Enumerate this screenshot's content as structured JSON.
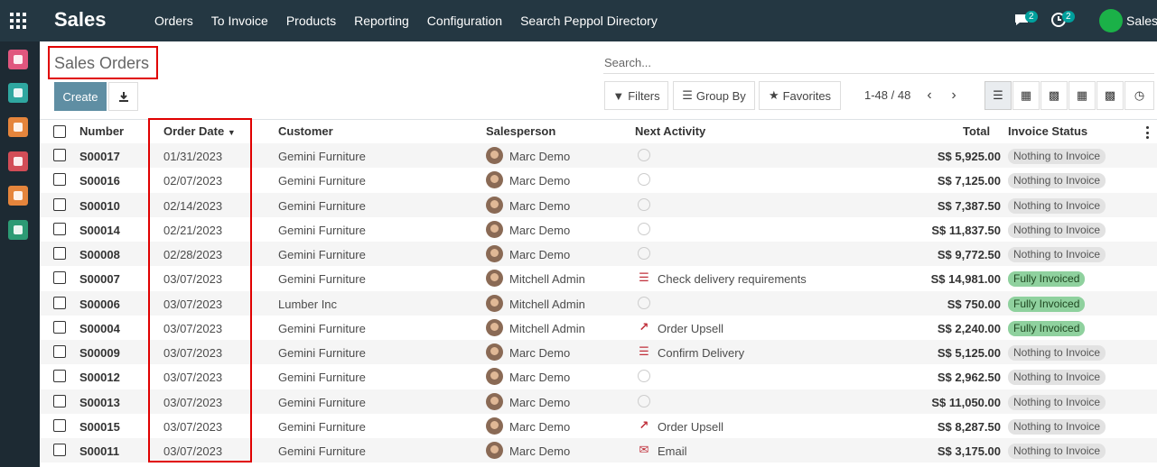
{
  "navbar": {
    "brand": "Sales",
    "menu": [
      "Orders",
      "To Invoice",
      "Products",
      "Reporting",
      "Configuration",
      "Search Peppol Directory"
    ],
    "messages_badge": "2",
    "activities_badge": "2",
    "user": "Sales"
  },
  "page": {
    "title": "Sales Orders",
    "create_label": "Create",
    "search_placeholder": "Search...",
    "filters_label": "Filters",
    "groupby_label": "Group By",
    "favorites_label": "Favorites",
    "pager": "1-48 / 48"
  },
  "table": {
    "headers": {
      "number": "Number",
      "order_date": "Order Date",
      "customer": "Customer",
      "salesperson": "Salesperson",
      "next_activity": "Next Activity",
      "total": "Total",
      "invoice_status": "Invoice Status"
    },
    "rows": [
      {
        "number": "S00017",
        "date": "01/31/2023",
        "customer": "Gemini Furniture",
        "salesperson": "Marc Demo",
        "activity": "",
        "activity_icon": "clock-icon",
        "total": "S$ 5,925.00",
        "status": "Nothing to Invoice"
      },
      {
        "number": "S00016",
        "date": "02/07/2023",
        "customer": "Gemini Furniture",
        "salesperson": "Marc Demo",
        "activity": "",
        "activity_icon": "clock-icon",
        "total": "S$ 7,125.00",
        "status": "Nothing to Invoice"
      },
      {
        "number": "S00010",
        "date": "02/14/2023",
        "customer": "Gemini Furniture",
        "salesperson": "Marc Demo",
        "activity": "",
        "activity_icon": "clock-icon",
        "total": "S$ 7,387.50",
        "status": "Nothing to Invoice"
      },
      {
        "number": "S00014",
        "date": "02/21/2023",
        "customer": "Gemini Furniture",
        "salesperson": "Marc Demo",
        "activity": "",
        "activity_icon": "clock-icon",
        "total": "S$ 11,837.50",
        "status": "Nothing to Invoice"
      },
      {
        "number": "S00008",
        "date": "02/28/2023",
        "customer": "Gemini Furniture",
        "salesperson": "Marc Demo",
        "activity": "",
        "activity_icon": "clock-icon",
        "total": "S$ 9,772.50",
        "status": "Nothing to Invoice"
      },
      {
        "number": "S00007",
        "date": "03/07/2023",
        "customer": "Gemini Furniture",
        "salesperson": "Mitchell Admin",
        "activity": "Check delivery requirements",
        "activity_icon": "list-icon",
        "total": "S$ 14,981.00",
        "status": "Fully Invoiced"
      },
      {
        "number": "S00006",
        "date": "03/07/2023",
        "customer": "Lumber Inc",
        "salesperson": "Mitchell Admin",
        "activity": "",
        "activity_icon": "clock-icon",
        "total": "S$ 750.00",
        "status": "Fully Invoiced"
      },
      {
        "number": "S00004",
        "date": "03/07/2023",
        "customer": "Gemini Furniture",
        "salesperson": "Mitchell Admin",
        "activity": "Order Upsell",
        "activity_icon": "chart-icon",
        "total": "S$ 2,240.00",
        "status": "Fully Invoiced"
      },
      {
        "number": "S00009",
        "date": "03/07/2023",
        "customer": "Gemini Furniture",
        "salesperson": "Marc Demo",
        "activity": "Confirm Delivery",
        "activity_icon": "list-icon",
        "total": "S$ 5,125.00",
        "status": "Nothing to Invoice"
      },
      {
        "number": "S00012",
        "date": "03/07/2023",
        "customer": "Gemini Furniture",
        "salesperson": "Marc Demo",
        "activity": "",
        "activity_icon": "clock-icon",
        "total": "S$ 2,962.50",
        "status": "Nothing to Invoice"
      },
      {
        "number": "S00013",
        "date": "03/07/2023",
        "customer": "Gemini Furniture",
        "salesperson": "Marc Demo",
        "activity": "",
        "activity_icon": "clock-icon",
        "total": "S$ 11,050.00",
        "status": "Nothing to Invoice"
      },
      {
        "number": "S00015",
        "date": "03/07/2023",
        "customer": "Gemini Furniture",
        "salesperson": "Marc Demo",
        "activity": "Order Upsell",
        "activity_icon": "chart-icon",
        "total": "S$ 8,287.50",
        "status": "Nothing to Invoice"
      },
      {
        "number": "S00011",
        "date": "03/07/2023",
        "customer": "Gemini Furniture",
        "salesperson": "Marc Demo",
        "activity": "Email",
        "activity_icon": "envelope-icon",
        "total": "S$ 3,175.00",
        "status": "Nothing to Invoice"
      }
    ]
  },
  "colors": {
    "navbar": "#243742",
    "sidebar": "#1d2a33",
    "primary": "#5f8ea3",
    "highlight_box": "#e00000",
    "activity_icon": "#c0303b",
    "fully_invoiced": "#8fd19e"
  }
}
